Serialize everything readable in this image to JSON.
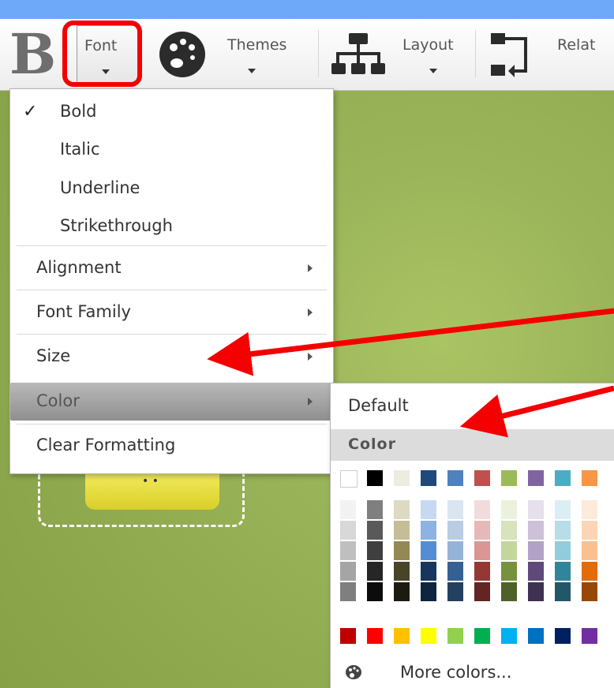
{
  "toolbar": {
    "bold_glyph": "B",
    "font_label": "Font",
    "themes_label": "Themes",
    "layout_label": "Layout",
    "relat_label": "Relat"
  },
  "font_menu": {
    "items": [
      {
        "label": "Bold",
        "checked": true
      },
      {
        "label": "Italic"
      },
      {
        "label": "Underline"
      },
      {
        "label": "Strikethrough"
      },
      {
        "label": "Alignment",
        "submenu": true
      },
      {
        "label": "Font Family",
        "submenu": true
      },
      {
        "label": "Size",
        "submenu": true
      },
      {
        "label": "Color",
        "submenu": true,
        "active": true
      },
      {
        "label": "Clear Formatting"
      }
    ],
    "check_glyph": "✓"
  },
  "color_submenu": {
    "default_label": "Default",
    "header": "Color",
    "more_colors_label": "More colors...",
    "swatches_top": [
      "#ffffff",
      "#000000",
      "#eeece1",
      "#1f497d",
      "#4f81bd",
      "#c0504d",
      "#9bbb59",
      "#8064a2",
      "#4bacc6",
      "#f79646"
    ],
    "swatches_shades": [
      [
        "#f2f2f2",
        "#7f7f7f",
        "#ddd9c3",
        "#c6d9f0",
        "#dbe5f1",
        "#f2dcdb",
        "#ebf1dd",
        "#e5e0ec",
        "#dbeef3",
        "#fdeada"
      ],
      [
        "#d8d8d8",
        "#595959",
        "#c4bd97",
        "#8db3e2",
        "#b8cce4",
        "#e5b9b7",
        "#d7e3bc",
        "#ccc1d9",
        "#b7dde8",
        "#fbd5b5"
      ],
      [
        "#bfbfbf",
        "#3f3f3f",
        "#938953",
        "#548dd4",
        "#95b3d7",
        "#d99694",
        "#c3d69b",
        "#b2a2c7",
        "#92cddc",
        "#fac08f"
      ],
      [
        "#a5a5a5",
        "#262626",
        "#494429",
        "#17365d",
        "#366092",
        "#953734",
        "#76923c",
        "#5f497a",
        "#31859b",
        "#e36c09"
      ],
      [
        "#7f7f7f",
        "#0c0c0c",
        "#1d1b10",
        "#0f243e",
        "#244061",
        "#632423",
        "#4f6128",
        "#3f3151",
        "#205867",
        "#974806"
      ]
    ],
    "swatches_standard": [
      "#c00000",
      "#ff0000",
      "#ffc000",
      "#ffff00",
      "#92d050",
      "#00b050",
      "#00b0f0",
      "#0070c0",
      "#002060",
      "#7030a0"
    ]
  },
  "colors": {
    "accent_red": "#f40000",
    "canvas_green": "#9bb55a",
    "outer_blue": "#6ea8f8"
  }
}
